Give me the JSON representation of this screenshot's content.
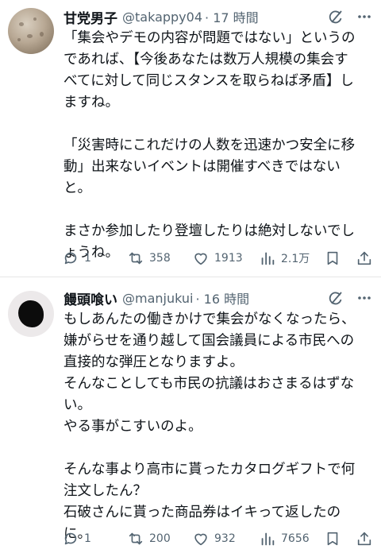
{
  "tweets": [
    {
      "name": "甘党男子",
      "handle": "@takappy04",
      "time": "· 17 時間",
      "lines": [
        "「集会やデモの内容が問題ではない」というの",
        "であれば、【今後あなたは数万人規模の集会す",
        "べてに対して同じスタンスを取らねば矛盾】し",
        "ますね。",
        "",
        "「災害時にこれだけの人数を迅速かつ安全に移",
        "動」出来ないイベントは開催すべきではない",
        "と。",
        "",
        "まさか参加したり登壇したりは絶対しないでし",
        "ょうね。"
      ],
      "replies": "1",
      "reposts": "358",
      "likes": "1913",
      "views": "2.1万"
    },
    {
      "name": "饅頭喰い",
      "handle": "@manjukui",
      "time": "· 16 時間",
      "lines": [
        "もしあんたの働きかけで集会がなくなったら、",
        "嫌がらせを通り越して国会議員による市民への",
        "直接的な弾圧となりますよ。",
        "そんなことしても市民の抗議はおさまるはずな",
        "い。",
        "やる事がこすいのよ。",
        "",
        "そんな事より高市に貰ったカタログギフトで何",
        "注文したん？",
        "石破さんに貰った商品券はイキって返したの",
        "に。"
      ],
      "replies": "1",
      "reposts": "200",
      "likes": "932",
      "views": "7656"
    }
  ],
  "icons": {
    "grok": "grok-icon",
    "more": "more-icon",
    "reply": "reply-icon",
    "repost": "repost-icon",
    "like": "like-icon",
    "views": "views-icon",
    "bookmark": "bookmark-icon",
    "share": "share-icon"
  },
  "colors": {
    "text": "#0f1419",
    "secondary": "#536471",
    "divider": "#e6e6e6"
  }
}
